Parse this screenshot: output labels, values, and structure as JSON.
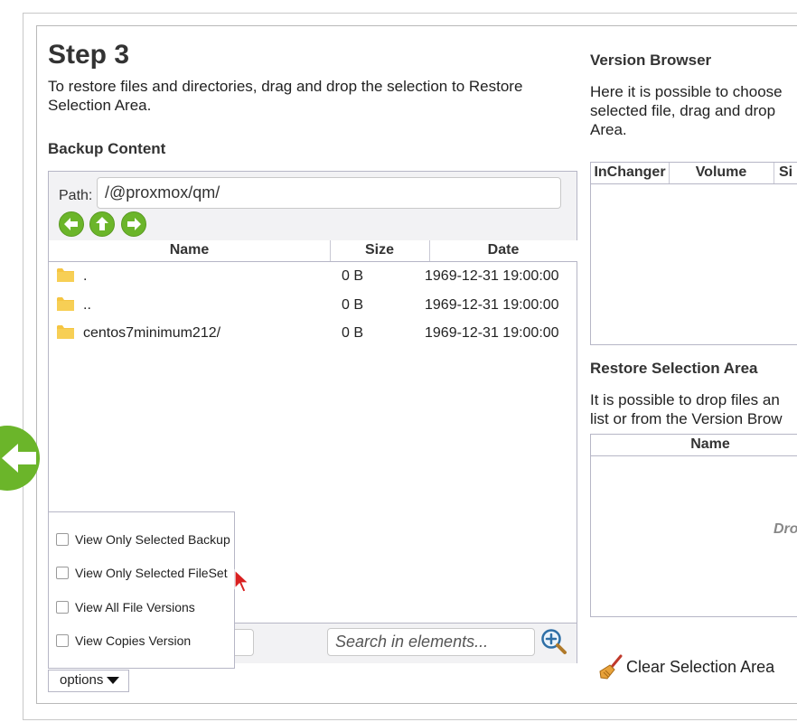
{
  "step": {
    "title": "Step 3",
    "description": "To restore files and directories, drag and drop the selection to Restore Selection Area."
  },
  "backup_content": {
    "heading": "Backup Content",
    "path_label": "Path:",
    "path_value": "/@proxmox/qm/",
    "columns": [
      "Name",
      "Size",
      "Date"
    ],
    "rows": [
      {
        "name": ".",
        "size": "0 B",
        "date": "1969-12-31 19:00:00"
      },
      {
        "name": "..",
        "size": "0 B",
        "date": "1969-12-31 19:00:00"
      },
      {
        "name": "centos7minimum212/",
        "size": "0 B",
        "date": "1969-12-31 19:00:00"
      }
    ],
    "search_placeholder": "Search in elements...",
    "options_label": "options",
    "options": [
      {
        "label": "View Only Selected Backup",
        "checked": false
      },
      {
        "label": "View Only Selected FileSet",
        "checked": false
      },
      {
        "label": "View All File Versions",
        "checked": false
      },
      {
        "label": "View Copies Version",
        "checked": false
      }
    ]
  },
  "version_browser": {
    "heading": "Version Browser",
    "description_lines": [
      "Here it is possible to choose",
      "selected file, drag and drop",
      "Area."
    ],
    "columns": [
      "InChanger",
      "Volume",
      "Si"
    ]
  },
  "restore_selection": {
    "heading": "Restore Selection Area",
    "description_lines": [
      "It is possible to drop files an",
      "list or from the Version Brow"
    ],
    "columns": [
      "Name"
    ],
    "drop_hint": "Dro",
    "clear_label": "Clear Selection Area"
  },
  "colors": {
    "accent_green": "#6bb52a",
    "border": "#b6b6c6",
    "toolbar_bg": "#f2f2f4",
    "folder_yellow": "#f5c542"
  },
  "icons": {
    "nav_back": "arrow-left-icon",
    "nav_up": "arrow-up-icon",
    "nav_forward": "arrow-right-icon",
    "folder": "folder-icon",
    "search": "zoom-in-icon",
    "clear": "broom-icon",
    "previous_step": "arrow-left-circle-icon"
  }
}
